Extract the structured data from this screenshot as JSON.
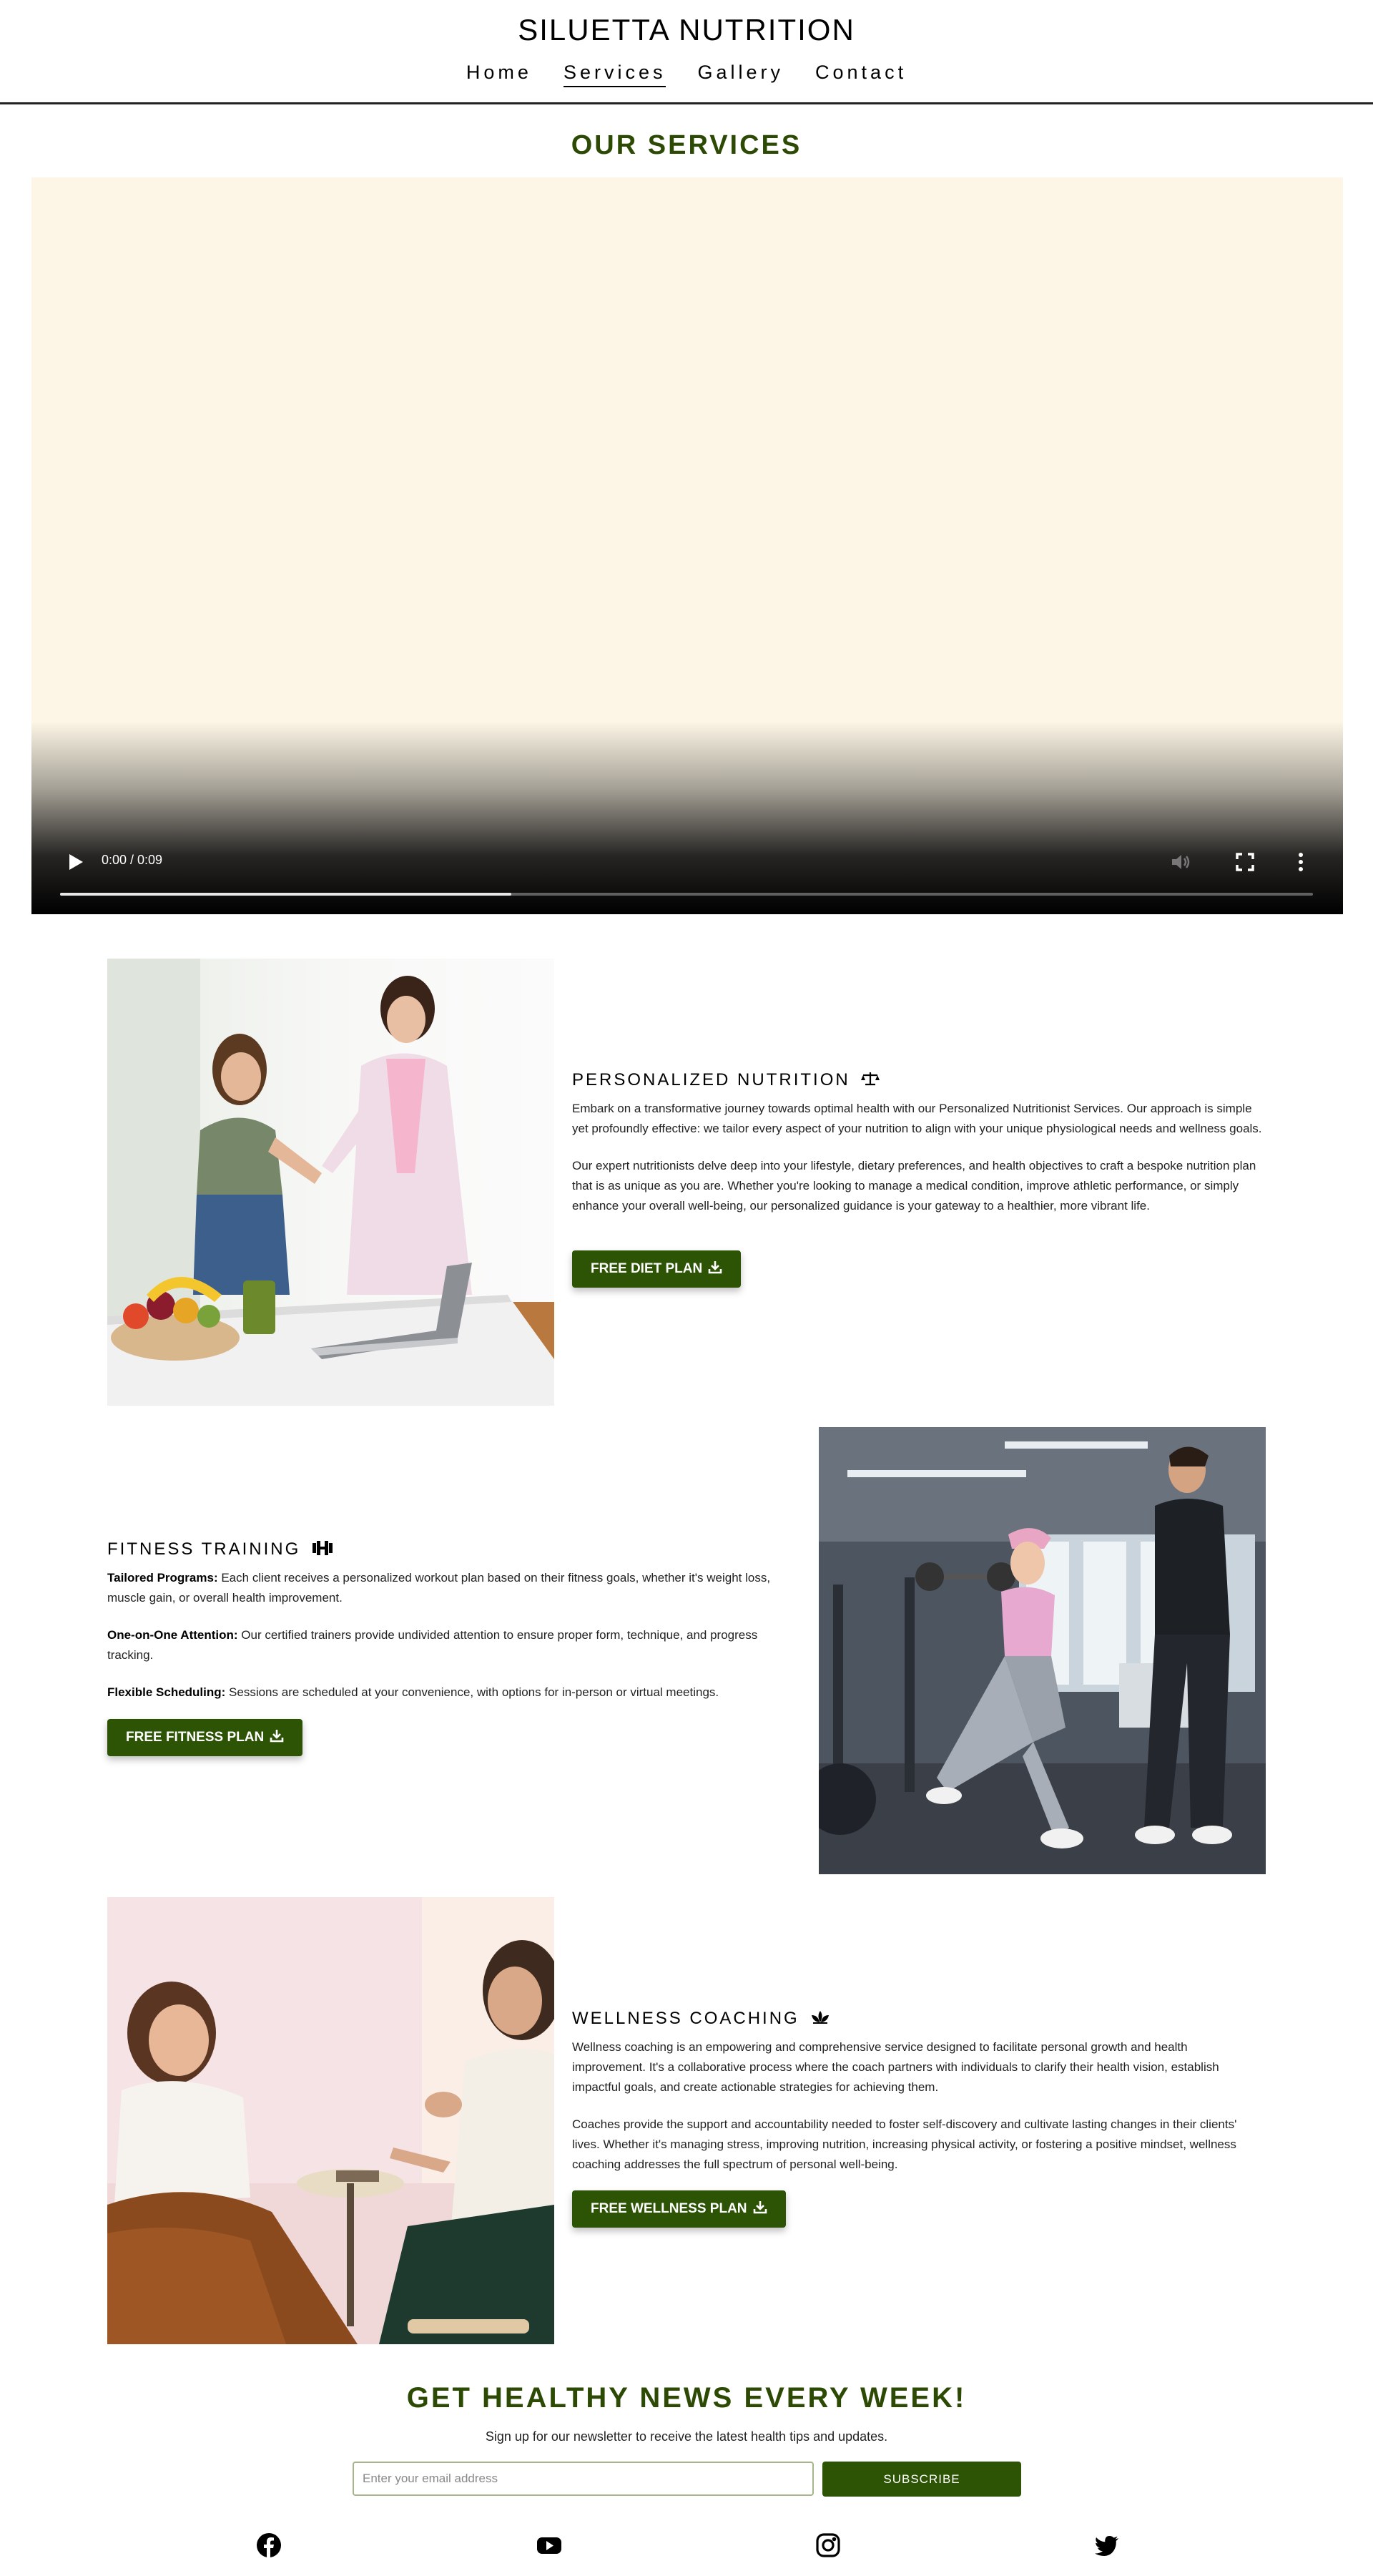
{
  "header": {
    "brand": "SILUETTA NUTRITION",
    "nav": [
      "Home",
      "Services",
      "Gallery",
      "Contact"
    ],
    "active_nav": "Services"
  },
  "services_heading": "OUR SERVICES",
  "video": {
    "time": "0:00 / 0:09",
    "progress_buffered": 0.36,
    "icons": [
      "play-icon",
      "volume-icon",
      "fullscreen-icon",
      "more-options-icon"
    ]
  },
  "services": [
    {
      "title": "PERSONALIZED NUTRITION",
      "title_icon": "balance-scale-icon",
      "paragraphs": [
        "Embark on a transformative journey towards optimal health with our Personalized Nutritionist Services. Our approach is simple yet profoundly effective: we tailor every aspect of your nutrition to align with your unique physiological needs and wellness goals.",
        "Our expert nutritionists delve deep into your lifestyle, dietary preferences, and health objectives to craft a bespoke nutrition plan that is as unique as you are. Whether you're looking to manage a medical condition, improve athletic performance, or simply enhance your overall well-being, our personalized guidance is your gateway to a healthier, more vibrant life."
      ],
      "button": "FREE DIET PLAN",
      "photo_alt": "Nutritionist shaking hands with a client beside a fruit bowl and laptop"
    },
    {
      "title": "FITNESS TRAINING",
      "title_icon": "dumbbell-icon",
      "items": [
        {
          "label": "Tailored Programs:",
          "text": " Each client receives a personalized workout plan based on their fitness goals, whether it's weight loss, muscle gain, or overall health improvement."
        },
        {
          "label": "One-on-One Attention:",
          "text": " Our certified trainers provide undivided attention to ensure proper form, technique, and progress tracking."
        },
        {
          "label": "Flexible Scheduling:",
          "text": " Sessions are scheduled at your convenience, with options for in-person or virtual meetings."
        }
      ],
      "button": "FREE FITNESS PLAN",
      "photo_alt": "Woman doing barbell lunges in a gym with a personal trainer"
    },
    {
      "title": "WELLNESS COACHING",
      "title_icon": "lotus-icon",
      "paragraphs": [
        "Wellness coaching is an empowering and comprehensive service designed to facilitate personal growth and health improvement. It's a collaborative process where the coach partners with individuals to clarify their health vision, establish impactful goals, and create actionable strategies for achieving them.",
        "Coaches provide the support and accountability needed to foster self-discovery and cultivate lasting changes in their clients' lives. Whether it's managing stress, improving nutrition, increasing physical activity, or fostering a positive mindset, wellness coaching addresses the full spectrum of personal well-being."
      ],
      "button": "FREE WELLNESS PLAN",
      "photo_alt": "Coach talking with a client in a bright room"
    }
  ],
  "newsletter": {
    "title": "GET HEALTHY NEWS EVERY WEEK!",
    "subtitle": "Sign up for our newsletter to receive the latest health tips and updates.",
    "email_placeholder": "Enter your email address",
    "button": "SUBSCRIBE"
  },
  "social": [
    "facebook-icon",
    "youtube-icon",
    "instagram-icon",
    "twitter-icon"
  ],
  "colors": {
    "accent_green": "#2d5405",
    "heading_green": "#2d4a05",
    "video_bg": "#fdf6e6"
  }
}
